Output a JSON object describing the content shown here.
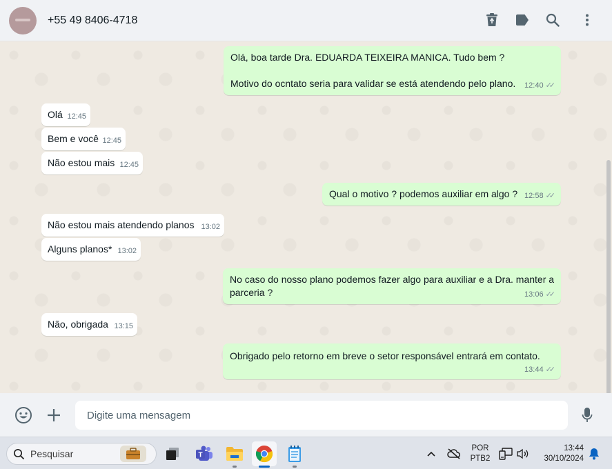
{
  "header": {
    "contact_name": "+55 49 8406-4718",
    "icons": [
      "trash-icon",
      "label-icon",
      "search-icon",
      "menu-icon"
    ]
  },
  "messages": [
    {
      "direction": "out",
      "text": "Olá, boa tarde Dra. EDUARDA TEIXEIRA MANICA. Tudo bem ?\n\nMotivo do ocntato seria para validar se está atendendo pelo plano.",
      "time": "12:40",
      "read": true
    },
    {
      "direction": "in",
      "text": "Olá",
      "time": "12:45"
    },
    {
      "direction": "in",
      "text": "Bem e você",
      "time": "12:45"
    },
    {
      "direction": "in",
      "text": "Não estou mais",
      "time": "12:45"
    },
    {
      "direction": "out",
      "text": "Qual o motivo ? podemos auxiliar em algo ?",
      "time": "12:58",
      "read": true
    },
    {
      "direction": "in",
      "text": "Não estou mais atendendo planos",
      "time": "13:02"
    },
    {
      "direction": "in",
      "text": "Alguns planos*",
      "time": "13:02"
    },
    {
      "direction": "out",
      "text": "No caso do nosso plano podemos fazer algo para auxiliar e a Dra. manter a parceria ?",
      "time": "13:06",
      "read": true
    },
    {
      "direction": "in",
      "text": "Não, obrigada",
      "time": "13:15"
    },
    {
      "direction": "out",
      "text": "Obrigado pelo retorno em breve o setor responsável entrará em contato.",
      "time": "13:44",
      "read": true
    }
  ],
  "footer": {
    "placeholder": "Digite uma mensagem",
    "icons": [
      "emoji-icon",
      "plus-icon",
      "microphone-icon"
    ]
  },
  "taskbar": {
    "search_label": "Pesquisar",
    "language_line1": "POR",
    "language_line2": "PTB2",
    "clock_time": "13:44",
    "clock_date": "30/10/2024"
  },
  "colors": {
    "outgoing_bubble": "#d9fdd3",
    "incoming_bubble": "#ffffff",
    "chat_background": "#efeae2",
    "header_background": "#f0f2f5",
    "read_ticks": "#8696a0"
  }
}
